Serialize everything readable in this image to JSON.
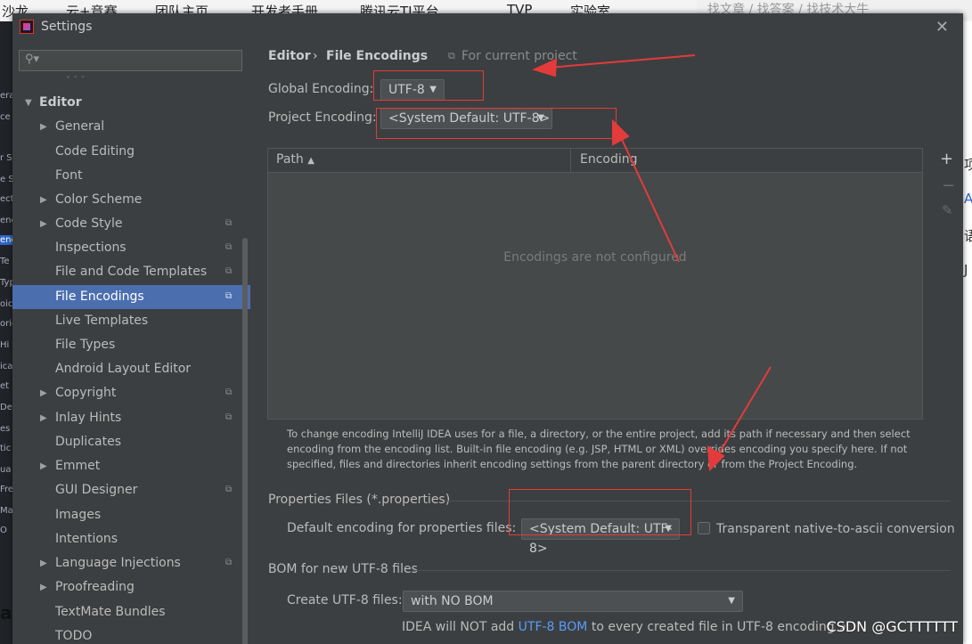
{
  "background": {
    "nav_items": [
      "沙龙",
      "云+竞赛",
      "团队主页",
      "开发者手册",
      "腾讯云TI平台",
      "TVP",
      "实验室"
    ],
    "search_placeholder": "找文章 / 找答案 / 找技术大牛",
    "left_fragments": [
      "era",
      "ce E",
      "r S",
      "e S",
      "ect",
      "enc",
      "enc",
      "Te",
      "Typ",
      "oic",
      "orig",
      "Hi",
      "ica",
      "et",
      "Des",
      "es",
      "tic",
      "ua",
      "Fre",
      "Ma",
      "O"
    ],
    "right_fragments": [
      "项",
      "A",
      "语",
      "J"
    ],
    "bottom_left_fragment": "at"
  },
  "dialog": {
    "title": "Settings",
    "close_glyph": "✕",
    "search_icon_glyph": "⚲▾"
  },
  "sidebar": {
    "partial_top": "˅  ˆ  ˇ",
    "items": [
      {
        "label": "Editor",
        "arrow": "▼",
        "proj": ""
      },
      {
        "label": "General",
        "arrow": "▶",
        "proj": ""
      },
      {
        "label": "Code Editing",
        "arrow": "",
        "proj": ""
      },
      {
        "label": "Font",
        "arrow": "",
        "proj": ""
      },
      {
        "label": "Color Scheme",
        "arrow": "▶",
        "proj": ""
      },
      {
        "label": "Code Style",
        "arrow": "▶",
        "proj": "⧉"
      },
      {
        "label": "Inspections",
        "arrow": "",
        "proj": "⧉"
      },
      {
        "label": "File and Code Templates",
        "arrow": "",
        "proj": "⧉"
      },
      {
        "label": "File Encodings",
        "arrow": "",
        "proj": "⧉"
      },
      {
        "label": "Live Templates",
        "arrow": "",
        "proj": ""
      },
      {
        "label": "File Types",
        "arrow": "",
        "proj": ""
      },
      {
        "label": "Android Layout Editor",
        "arrow": "",
        "proj": ""
      },
      {
        "label": "Copyright",
        "arrow": "▶",
        "proj": "⧉"
      },
      {
        "label": "Inlay Hints",
        "arrow": "▶",
        "proj": "⧉"
      },
      {
        "label": "Duplicates",
        "arrow": "",
        "proj": ""
      },
      {
        "label": "Emmet",
        "arrow": "▶",
        "proj": ""
      },
      {
        "label": "GUI Designer",
        "arrow": "",
        "proj": "⧉"
      },
      {
        "label": "Images",
        "arrow": "",
        "proj": ""
      },
      {
        "label": "Intentions",
        "arrow": "",
        "proj": ""
      },
      {
        "label": "Language Injections",
        "arrow": "▶",
        "proj": "⧉"
      },
      {
        "label": "Proofreading",
        "arrow": "▶",
        "proj": ""
      },
      {
        "label": "TextMate Bundles",
        "arrow": "",
        "proj": ""
      },
      {
        "label": "TODO",
        "arrow": "",
        "proj": ""
      }
    ],
    "selected": "File Encodings"
  },
  "breadcrumb": {
    "parent": "Editor",
    "separator": "›",
    "current": "File Encodings",
    "scope_icon": "⧉",
    "scope": "For current project"
  },
  "global_encoding": {
    "label": "Global Encoding:",
    "value": "UTF-8",
    "arrow": "▼"
  },
  "project_encoding": {
    "label": "Project Encoding:",
    "value": "<System Default: UTF-8>",
    "arrow": "▼"
  },
  "table": {
    "col_path": "Path",
    "sort_icon": "▲",
    "col_encoding": "Encoding",
    "empty": "Encodings are not configured",
    "add_glyph": "+",
    "remove_glyph": "−",
    "edit_glyph": "✎"
  },
  "description": "To change encoding IntelliJ IDEA uses for a file, a directory, or the entire project, add its path if necessary and then select encoding from the encoding list. Built-in file encoding (e.g. JSP, HTML or XML) overrides encoding you specify here. If not specified, files and directories inherit encoding settings from the parent directory or from the Project Encoding.",
  "properties": {
    "section": "Properties Files (*.properties)",
    "label": "Default encoding for properties files:",
    "value": "<System Default: UTF-8>",
    "arrow": "▼",
    "transparent_label": "Transparent native-to-ascii conversion",
    "transparent_checked": false
  },
  "bom": {
    "section": "BOM for new UTF-8 files",
    "label": "Create UTF-8 files:",
    "value": "with NO BOM",
    "arrow": "▼",
    "note_prefix": "IDEA will NOT add",
    "note_link": "UTF-8 BOM",
    "note_suffix": "to every created file in UTF-8 encoding",
    "note_icon": "↗"
  },
  "watermark": "CSDN @GCTTTTTT",
  "colors": {
    "dialog_bg": "#3c3f41",
    "selection": "#4b6eaf",
    "text": "#bbbbbb",
    "link": "#589df6",
    "annotation_red": "#e33b3b"
  }
}
